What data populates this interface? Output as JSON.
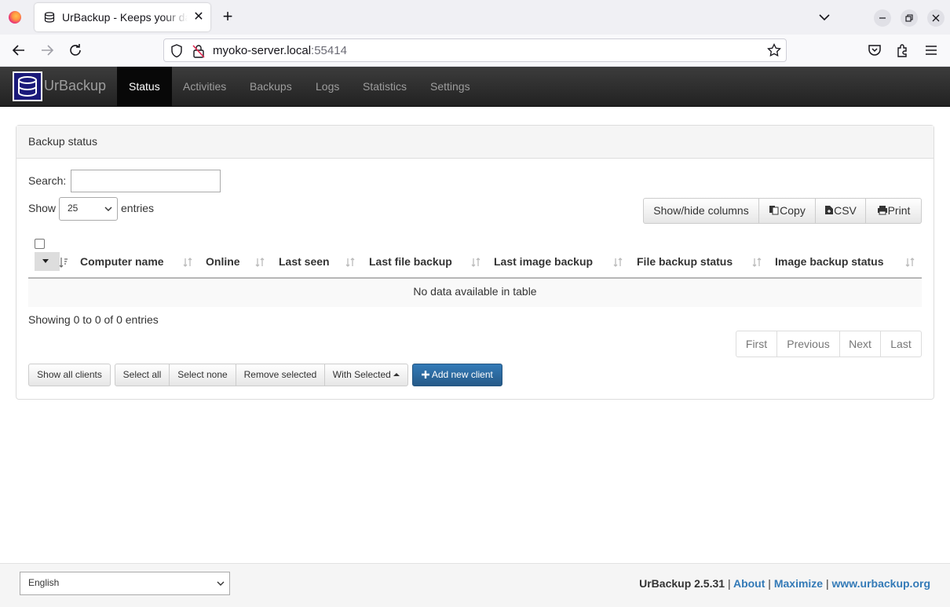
{
  "browser": {
    "tab_title": "UrBackup - Keeps your data safe",
    "url_host": "myoko-server.local",
    "url_port": ":55414"
  },
  "app": {
    "brand": "UrBackup",
    "nav": [
      "Status",
      "Activities",
      "Backups",
      "Logs",
      "Statistics",
      "Settings"
    ],
    "active_nav": "Status"
  },
  "panel": {
    "title": "Backup status",
    "search_label": "Search:",
    "search_value": "",
    "show_label": "Show",
    "entries_value": "25",
    "entries_label": "entries",
    "buttons": {
      "show_hide": "Show/hide columns",
      "copy": "Copy",
      "csv": "CSV",
      "print": "Print"
    },
    "columns": [
      "Computer name",
      "Online",
      "Last seen",
      "Last file backup",
      "Last image backup",
      "File backup status",
      "Image backup status"
    ],
    "empty_message": "No data available in table",
    "info": "Showing 0 to 0 of 0 entries",
    "pager": [
      "First",
      "Previous",
      "Next",
      "Last"
    ],
    "actions": {
      "show_all": "Show all clients",
      "select_all": "Select all",
      "select_none": "Select none",
      "remove_selected": "Remove selected",
      "with_selected": "With Selected",
      "add_client": "Add new client"
    }
  },
  "footer": {
    "language": "English",
    "version": "UrBackup 2.5.31",
    "sep": "|",
    "about": "About",
    "maximize": "Maximize",
    "site": "www.urbackup.org"
  }
}
